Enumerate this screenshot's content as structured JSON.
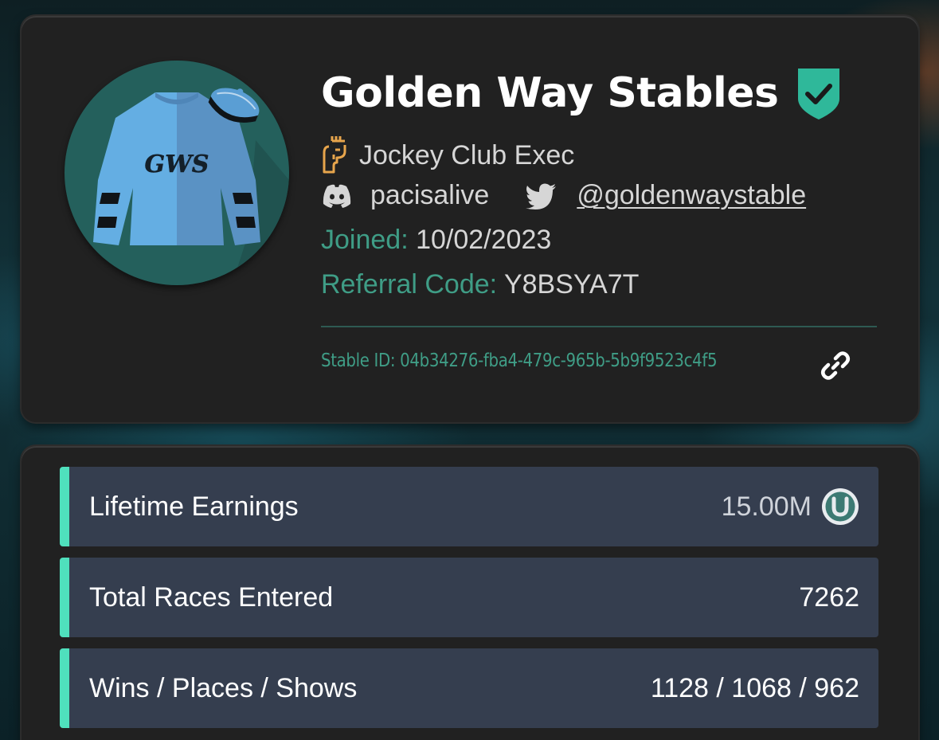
{
  "profile": {
    "stable_name": "Golden Way Stables",
    "verified_icon": "shield-check-icon",
    "rank_icon": "castle-tower-icon",
    "rank": "Jockey Club Exec",
    "discord_icon": "discord-icon",
    "discord_handle": "pacisalive",
    "twitter_icon": "twitter-icon",
    "twitter_handle": "@goldenwaystable",
    "joined_label": "Joined:",
    "joined_date": "10/02/2023",
    "referral_label": "Referral Code:",
    "referral_code": "Y8BSYA7T",
    "stable_id_label": "Stable ID:",
    "stable_id": "04b34276-fba4-479c-965b-5b9f9523c4f5",
    "link_icon": "link-icon",
    "silks_initials": "GWS"
  },
  "stats": [
    {
      "label": "Lifetime Earnings",
      "value": "15.00M",
      "icon": "horseshoe-coin-icon"
    },
    {
      "label": "Total Races Entered",
      "value": "7262"
    },
    {
      "label": "Wins / Places / Shows",
      "value": "1128 / 1068 / 962"
    }
  ],
  "colors": {
    "accent_green": "#3f9d86",
    "stat_accent": "#4fe0bd",
    "card_bg": "#212121",
    "stat_bg": "#353e4f",
    "rank_gold": "#e7a54c",
    "silks_blue": "#5ea8e0"
  }
}
